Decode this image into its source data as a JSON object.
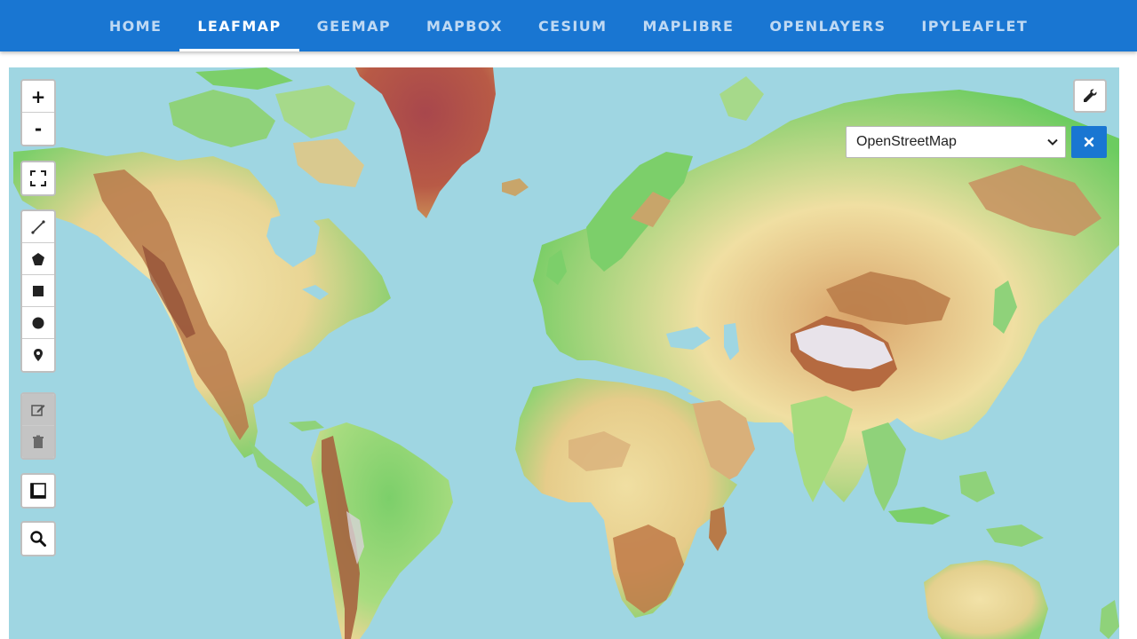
{
  "nav": {
    "tabs": [
      {
        "label": "HOME"
      },
      {
        "label": "LEAFMAP"
      },
      {
        "label": "GEEMAP"
      },
      {
        "label": "MAPBOX"
      },
      {
        "label": "CESIUM"
      },
      {
        "label": "MAPLIBRE"
      },
      {
        "label": "OPENLAYERS"
      },
      {
        "label": "IPYLEAFLET"
      }
    ],
    "active_tab": "LEAFMAP"
  },
  "map": {
    "zoom_in_label": "+",
    "zoom_out_label": "-",
    "basemap_selected": "OpenStreetMap",
    "controls": [
      "zoom-in-icon",
      "zoom-out-icon",
      "fullscreen-icon",
      "polyline-icon",
      "polygon-icon",
      "rectangle-icon",
      "circle-icon",
      "marker-icon",
      "edit-icon",
      "trash-icon",
      "measure-icon",
      "search-icon",
      "wrench-icon",
      "close-icon"
    ]
  },
  "colors": {
    "nav_bg": "#1976d2",
    "ocean": "#9fd6e2",
    "accent": "#1976d2"
  }
}
